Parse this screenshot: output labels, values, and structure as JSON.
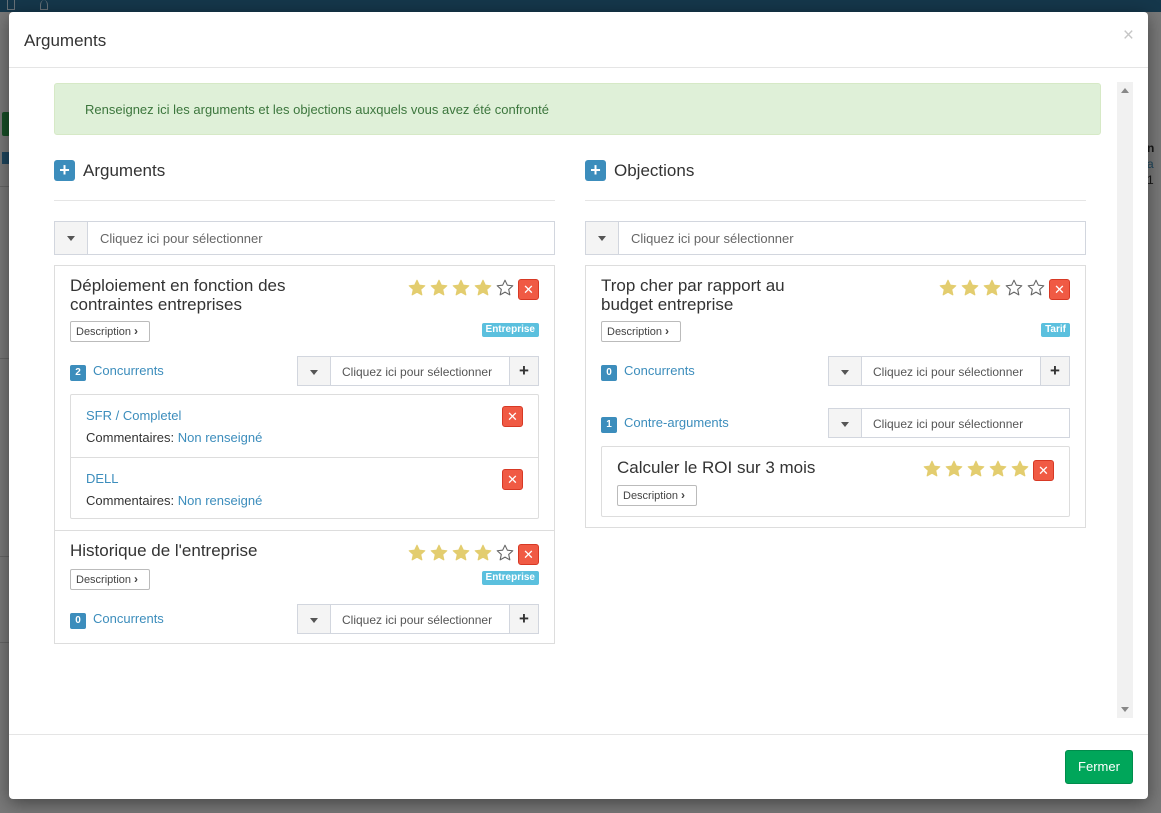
{
  "modal": {
    "title": "Arguments",
    "close_glyph": "×",
    "footer_button": "Fermer"
  },
  "alert": {
    "text": "Renseignez ici les arguments et les objections auxquels vous avez été confronté"
  },
  "colors": {
    "primary": "#3c8dbc",
    "success": "#00a65a",
    "danger": "#f05a44",
    "info_tag": "#5bc0de",
    "star": "#e3cd6f",
    "alert_bg": "#dff0d8"
  },
  "arguments": {
    "add_icon": "plus-icon",
    "title": "Arguments",
    "select_placeholder": "Cliquez ici pour sélectionner",
    "items": [
      {
        "title": "Déploiement en fonction des contraintes entreprises",
        "rating": 4,
        "max_rating": 5,
        "description_label": "Description",
        "tag": "Entreprise",
        "concurrents": {
          "count": "2",
          "label": "Concurrents",
          "placeholder": "Cliquez ici pour sélectionner",
          "list": [
            {
              "name": "SFR / Completel",
              "comment_label": "Commentaires:",
              "comment_value": "Non renseigné"
            },
            {
              "name": "DELL",
              "comment_label": "Commentaires:",
              "comment_value": "Non renseigné"
            }
          ]
        }
      },
      {
        "title": "Historique de l'entreprise",
        "rating": 4,
        "max_rating": 5,
        "description_label": "Description",
        "tag": "Entreprise",
        "concurrents": {
          "count": "0",
          "label": "Concurrents",
          "placeholder": "Cliquez ici pour sélectionner"
        }
      }
    ]
  },
  "objections": {
    "add_icon": "plus-icon",
    "title": "Objections",
    "select_placeholder": "Cliquez ici pour sélectionner",
    "items": [
      {
        "title": "Trop cher par rapport au budget entreprise",
        "rating": 3,
        "max_rating": 5,
        "description_label": "Description",
        "tag": "Tarif",
        "concurrents": {
          "count": "0",
          "label": "Concurrents",
          "placeholder": "Cliquez ici pour sélectionner"
        },
        "contre_arguments": {
          "count": "1",
          "label": "Contre-arguments",
          "placeholder": "Cliquez ici pour sélectionner",
          "list": [
            {
              "title": "Calculer le ROI sur 3 mois",
              "rating": 5,
              "max_rating": 5,
              "description_label": "Description"
            }
          ]
        }
      }
    ]
  }
}
